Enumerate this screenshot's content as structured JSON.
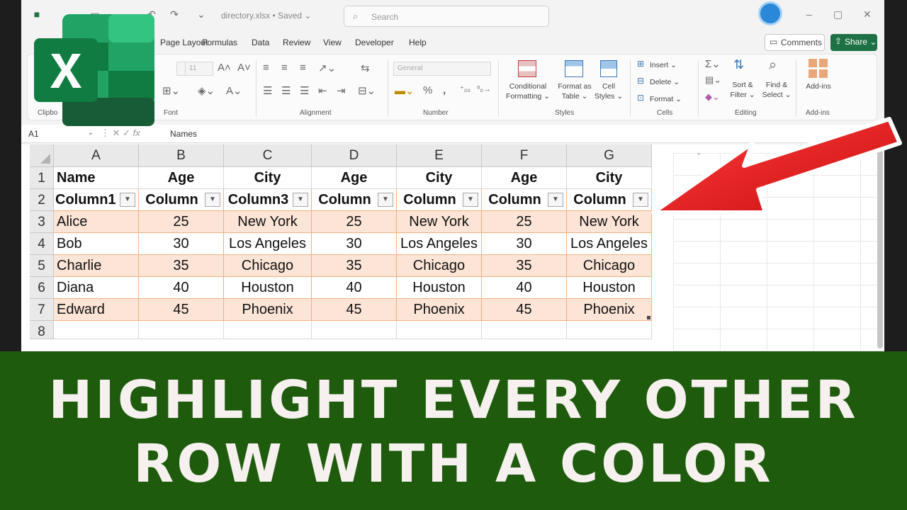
{
  "titlebar": {
    "filename": "directory.xlsx • Saved ⌄",
    "search_placeholder": "Search"
  },
  "menu": {
    "items": [
      "Page Layout",
      "Formulas",
      "Data",
      "Review",
      "View",
      "Developer",
      "Help"
    ],
    "comments": "Comments",
    "share": "Share ⌄"
  },
  "ribbon": {
    "font_size": "11",
    "number_format": "General",
    "groups": {
      "clipboard": "Clipbo",
      "font": "Font",
      "alignment": "Alignment",
      "number": "Number",
      "styles": "Styles",
      "cells": "Cells",
      "editing": "Editing",
      "addins": "Add-ins"
    },
    "buttons": {
      "conditional_formatting": "Conditional\nFormatting ⌄",
      "format_as_table": "Format as\nTable ⌄",
      "cell_styles": "Cell\nStyles ⌄",
      "insert": "Insert ⌄",
      "delete": "Delete ⌄",
      "format": "Format ⌄",
      "sort_filter": "Sort &\nFilter ⌄",
      "find_select": "Find &\nSelect ⌄",
      "addins": "Add-ins"
    }
  },
  "formula_bar": {
    "name_box": "A1",
    "value": "Names"
  },
  "sheet": {
    "columns": [
      "A",
      "B",
      "C",
      "D",
      "E",
      "F",
      "G"
    ],
    "row_numbers": [
      "1",
      "2",
      "3",
      "4",
      "5",
      "6",
      "7",
      "8"
    ],
    "header_row": [
      "Name",
      "Age",
      "City",
      "Age",
      "City",
      "Age",
      "City"
    ],
    "table_headers": [
      "Column1",
      "Column",
      "Column3",
      "Column",
      "Column",
      "Column",
      "Column"
    ],
    "rows": [
      [
        "Alice",
        "25",
        "New York",
        "25",
        "New York",
        "25",
        "New York"
      ],
      [
        "Bob",
        "30",
        "Los Angeles",
        "30",
        "Los Angeles",
        "30",
        "Los Angeles"
      ],
      [
        "Charlie",
        "35",
        "Chicago",
        "35",
        "Chicago",
        "35",
        "Chicago"
      ],
      [
        "Diana",
        "40",
        "Houston",
        "40",
        "Houston",
        "40",
        "Houston"
      ],
      [
        "Edward",
        "45",
        "Phoenix",
        "45",
        "Phoenix",
        "45",
        "Phoenix"
      ]
    ],
    "band_color": "#fce4d6",
    "border_color": "#f4b183"
  },
  "banner": {
    "line1": "HIGHLIGHT EVERY OTHER",
    "line2": "ROW WITH A COLOR",
    "background": "#1e5b0d"
  },
  "colors": {
    "excel_green": "#1e7145",
    "arrow_red": "#e0201f"
  }
}
